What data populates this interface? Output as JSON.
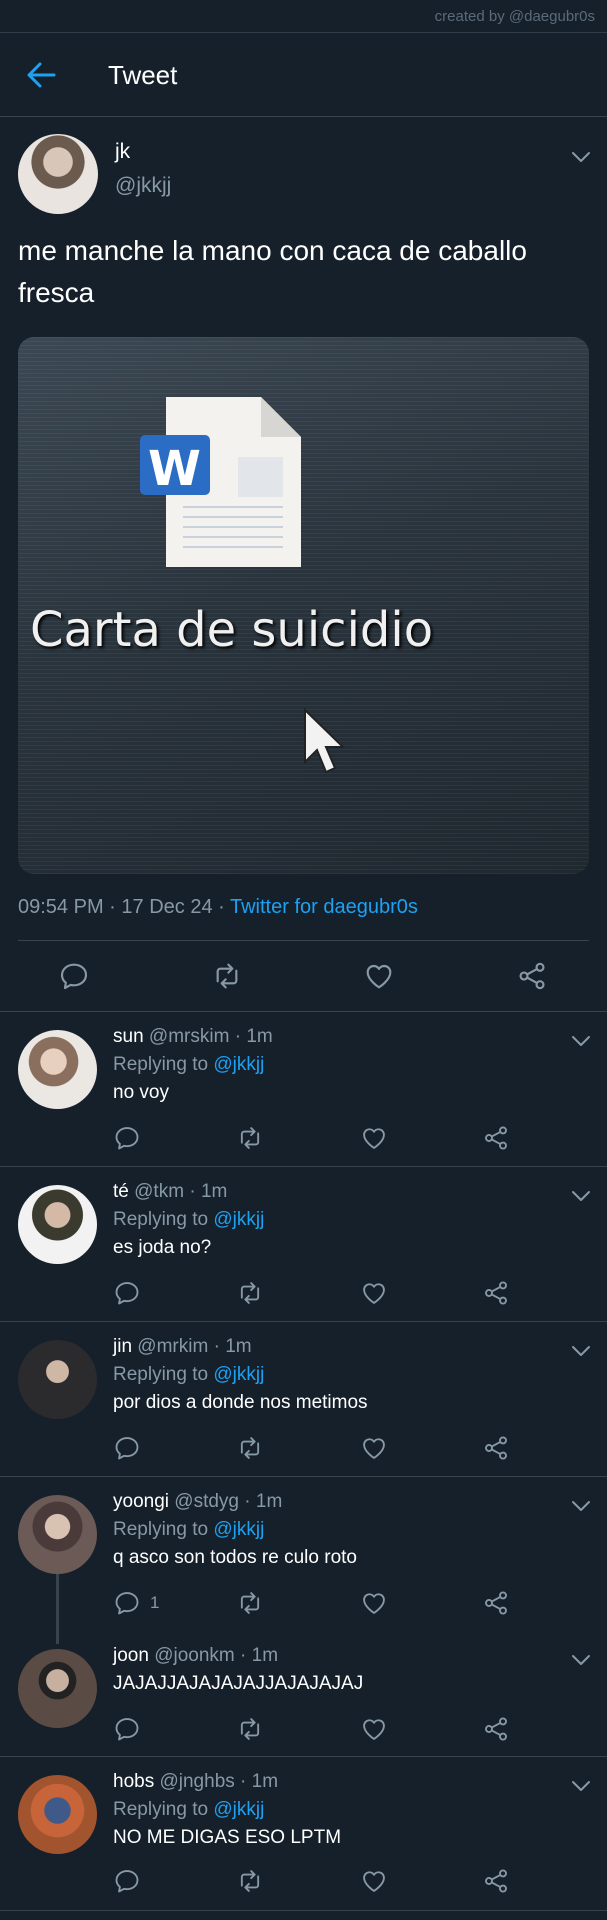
{
  "credit": "created by @daegubr0s",
  "header": {
    "title": "Tweet"
  },
  "tweet": {
    "name": "jk",
    "handle": "@jkkjj",
    "text": "me manche la mano con caca de caballo fresca",
    "media_caption": "Carta de suicidio",
    "time": "09:54 PM",
    "date": "17 Dec 24",
    "source": "Twitter for daegubr0s",
    "sep": "·"
  },
  "replies": [
    {
      "name": "sun",
      "handle": "@mrskim",
      "time": "1m",
      "replying_label": "Replying to",
      "replying_to": "@jkkjj",
      "text": "no voy",
      "reply_count": ""
    },
    {
      "name": "té",
      "handle": "@tkm",
      "time": "1m",
      "replying_label": "Replying to",
      "replying_to": "@jkkjj",
      "text": "es joda no?",
      "reply_count": ""
    },
    {
      "name": "jin",
      "handle": "@mrkim",
      "time": "1m",
      "replying_label": "Replying to",
      "replying_to": "@jkkjj",
      "text": "por dios a donde nos metimos",
      "reply_count": ""
    },
    {
      "name": "yoongi",
      "handle": "@stdyg",
      "time": "1m",
      "replying_label": "Replying to",
      "replying_to": "@jkkjj",
      "text": "q asco son todos re culo roto",
      "reply_count": "1"
    },
    {
      "name": "joon",
      "handle": "@joonkm",
      "time": "1m",
      "text": "JAJAJJAJAJAJAJJAJAJAJAJ",
      "reply_count": ""
    },
    {
      "name": "hobs",
      "handle": "@jnghbs",
      "time": "1m",
      "replying_label": "Replying to",
      "replying_to": "@jkkjj",
      "text": "NO ME DIGAS ESO LPTM",
      "reply_count": ""
    }
  ],
  "icons": [
    "back-arrow-icon",
    "chevron-down-icon",
    "comment-icon",
    "retweet-icon",
    "like-icon",
    "share-icon",
    "word-doc-icon",
    "mouse-cursor-icon"
  ],
  "colors": {
    "background": "#15202b",
    "accent": "#1da1f2",
    "secondary_text": "#8899a6",
    "divider": "#38444d"
  }
}
